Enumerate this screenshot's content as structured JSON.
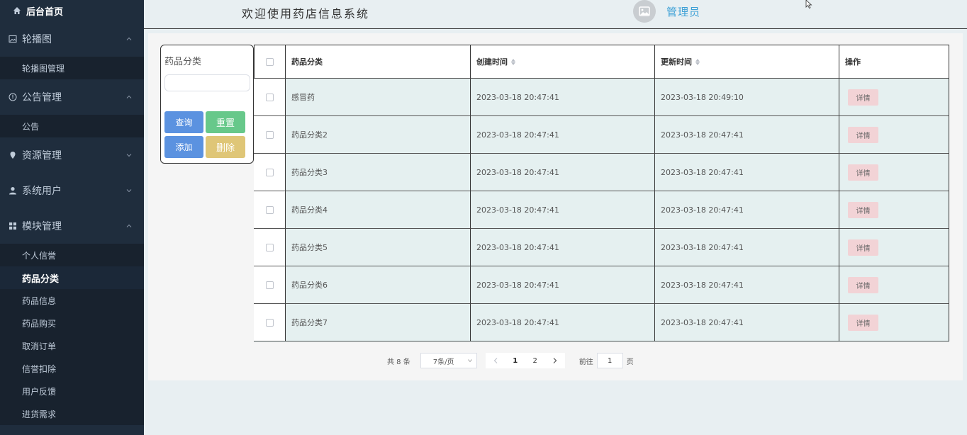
{
  "sidebar": {
    "home": "后台首页",
    "groups": [
      {
        "label": "轮播图",
        "icon": "image-icon",
        "items": [
          "轮播图管理"
        ]
      },
      {
        "label": "公告管理",
        "icon": "info-circle-icon",
        "items": [
          "公告"
        ]
      },
      {
        "label": "资源管理",
        "icon": "location-pin-icon",
        "items": []
      },
      {
        "label": "系统用户",
        "icon": "user-icon",
        "items": []
      },
      {
        "label": "模块管理",
        "icon": "grid-icon",
        "items": [
          "个人信誉",
          "药品分类",
          "药品信息",
          "药品购买",
          "取消订单",
          "信誉扣除",
          "用户反馈",
          "进货需求"
        ]
      }
    ],
    "active_item": "药品分类"
  },
  "header": {
    "title": "欢迎使用药店信息系统",
    "user": "管理员"
  },
  "filter": {
    "label": "药品分类",
    "input_value": "",
    "buttons": {
      "query": "查询",
      "reset": "重置",
      "add": "添加",
      "delete": "删除"
    }
  },
  "table": {
    "columns": [
      "药品分类",
      "创建时间",
      "更新时间",
      "操作"
    ],
    "detail_label": "详情",
    "rows": [
      {
        "name": "感冒药",
        "created": "2023-03-18 20:47:41",
        "updated": "2023-03-18 20:49:10"
      },
      {
        "name": "药品分类2",
        "created": "2023-03-18 20:47:41",
        "updated": "2023-03-18 20:47:41"
      },
      {
        "name": "药品分类3",
        "created": "2023-03-18 20:47:41",
        "updated": "2023-03-18 20:47:41"
      },
      {
        "name": "药品分类4",
        "created": "2023-03-18 20:47:41",
        "updated": "2023-03-18 20:47:41"
      },
      {
        "name": "药品分类5",
        "created": "2023-03-18 20:47:41",
        "updated": "2023-03-18 20:47:41"
      },
      {
        "name": "药品分类6",
        "created": "2023-03-18 20:47:41",
        "updated": "2023-03-18 20:47:41"
      },
      {
        "name": "药品分类7",
        "created": "2023-03-18 20:47:41",
        "updated": "2023-03-18 20:47:41"
      }
    ]
  },
  "pagination": {
    "total": "共 8 条",
    "page_size": "7条/页",
    "pages": [
      "1",
      "2"
    ],
    "current_page": "1",
    "goto_label": "前往",
    "goto_value": "1",
    "page_suffix": "页"
  },
  "colors": {
    "sidebar_bg": "#1f2d3d",
    "accent_blue": "#5b92e0",
    "accent_green": "#67c88a",
    "accent_yellow": "#dfc677",
    "detail_bg": "#f2d3d6",
    "user_link": "#3a9fd6"
  }
}
